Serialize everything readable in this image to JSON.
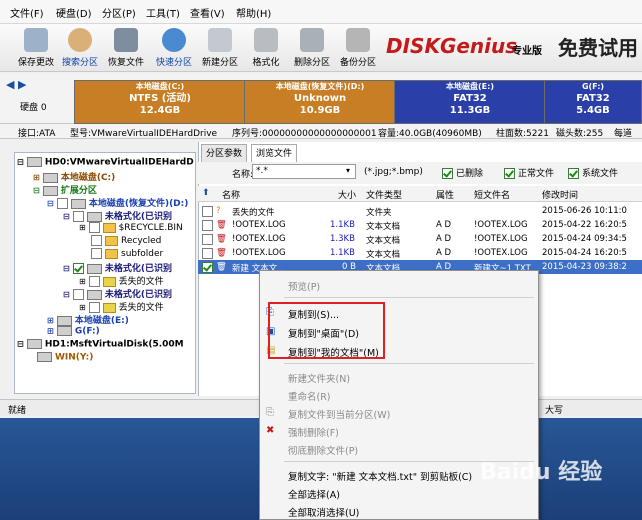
{
  "menu": [
    "文件(F)",
    "硬盘(D)",
    "分区(P)",
    "工具(T)",
    "查看(V)",
    "帮助(H)"
  ],
  "toolbar": [
    "保存更改",
    "搜索分区",
    "恢复文件",
    "快速分区",
    "新建分区",
    "格式化",
    "删除分区",
    "备份分区"
  ],
  "brand": {
    "logo": "DISKGenius",
    "edition": "专业版",
    "tag": "免费试用"
  },
  "disk": {
    "label": "硬盘 0",
    "partitions": [
      {
        "name": "本地磁盘(C:)",
        "fs": "NTFS (活动)",
        "size": "12.4GB"
      },
      {
        "name": "本地磁盘(恢复文件)(D:)",
        "fs": "Unknown",
        "size": "10.9GB"
      },
      {
        "name": "本地磁盘(E:)",
        "fs": "FAT32",
        "size": "11.3GB"
      },
      {
        "name": "G(F:)",
        "fs": "FAT32",
        "size": "5.4GB"
      }
    ]
  },
  "info": {
    "iface": "接口:ATA",
    "model": "型号:VMwareVirtualIDEHardDrive",
    "serial": "序列号:00000000000000000001",
    "cap": "容量:40.0GB(40960MB)",
    "cyl": "柱面数:5221",
    "heads": "磁头数:255",
    "sectors": "每道"
  },
  "tree": [
    "HD0:VMwareVirtualIDEHardD",
    "本地磁盘(C:)",
    "扩展分区",
    "本地磁盘(恢复文件)(D:)",
    "未格式化(已识别",
    "$RECYCLE.BIN",
    "Recycled",
    "subfolder",
    "未格式化(已识别",
    "丢失的文件",
    "未格式化(已识别",
    "丢失的文件",
    "本地磁盘(E:)",
    "G(F:)",
    "HD1:MsftVirtualDisk(5.00M",
    "WIN(Y:)"
  ],
  "tabs": [
    "分区参数",
    "浏览文件"
  ],
  "filter": {
    "label": "名称:",
    "value": "*.*",
    "ext": "(*.jpg;*.bmp)",
    "options": [
      "已删除",
      "正常文件",
      "系统文件"
    ]
  },
  "columns": [
    "名称",
    "大小",
    "文件类型",
    "属性",
    "短文件名",
    "修改时间"
  ],
  "rows": [
    {
      "name": "丢失的文件",
      "size": "",
      "type": "文件夹",
      "attr": "",
      "short": "",
      "time": "2015-06-26 10:11:0"
    },
    {
      "name": "!OOTEX.LOG",
      "size": "1.1KB",
      "type": "文本文档",
      "attr": "A D",
      "short": "!OOTEX.LOG",
      "time": "2015-04-22 16:20:5"
    },
    {
      "name": "!OOTEX.LOG",
      "size": "1.3KB",
      "type": "文本文档",
      "attr": "A D",
      "short": "!OOTEX.LOG",
      "time": "2015-04-24 09:34:5"
    },
    {
      "name": "!OOTEX.LOG",
      "size": "1.1KB",
      "type": "文本文档",
      "attr": "A D",
      "short": "!OOTEX.LOG",
      "time": "2015-04-24 16:20:5"
    },
    {
      "name": "新建 文本文...",
      "size": "0 B",
      "type": "文本文档",
      "attr": "A D",
      "short": "新建文~1.TXT",
      "time": "2015-04-23 09:38:2"
    }
  ],
  "status": {
    "left": "就绪",
    "right": "大写"
  },
  "context": {
    "preview": "预览(P)",
    "copy_to": "复制到(S)...",
    "copy_desktop": "复制到\"桌面\"(D)",
    "copy_docs": "复制到\"我的文档\"(M)",
    "new_folder": "新建文件夹(N)",
    "rename": "重命名(R)",
    "copy_current": "复制文件到当前分区(W)",
    "force_delete": "强制删除(F)",
    "perm_delete": "彻底删除文件(P)",
    "copy_text": "复制文字: \"新建 文本文档.txt\" 到剪贴板(C)",
    "select_all": "全部选择(A)",
    "deselect_all": "全部取消选择(U)"
  },
  "watermark": "Baidu 经验"
}
